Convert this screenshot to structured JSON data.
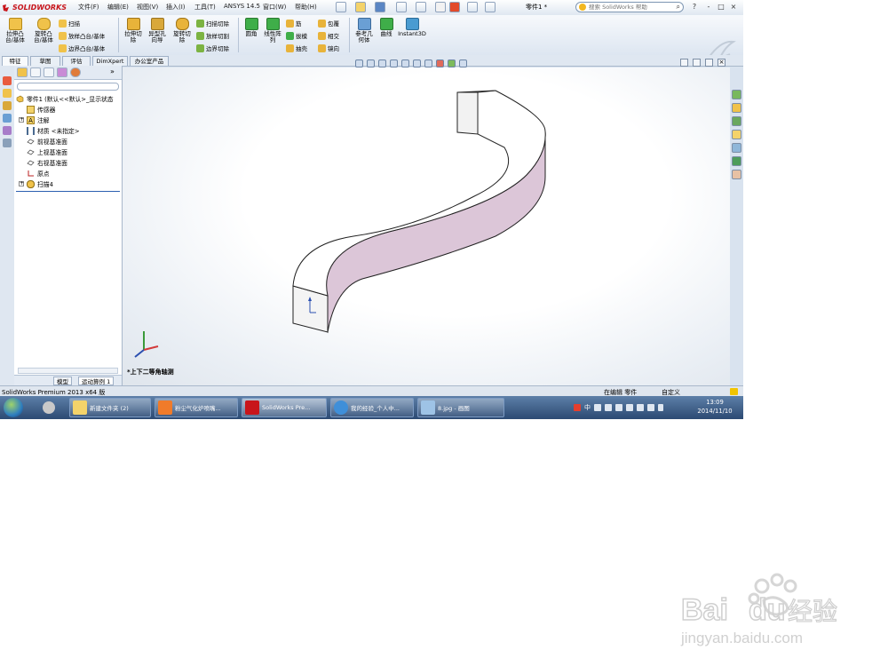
{
  "app": {
    "logo_text": "SOLIDWORKS",
    "menus": [
      "文件(F)",
      "编辑(E)",
      "视图(V)",
      "插入(I)",
      "工具(T)",
      "ANSYS 14.5",
      "窗口(W)",
      "帮助(H)"
    ],
    "document_title": "零件1 *",
    "help_search_placeholder": "搜索 SolidWorks 帮助",
    "window_controls": [
      "?",
      "-",
      "□",
      "×"
    ]
  },
  "command_manager": {
    "big_buttons": [
      {
        "label_1": "拉伸凸",
        "label_2": "台/基体",
        "icon": "extrude-boss-icon"
      },
      {
        "label_1": "旋转凸",
        "label_2": "台/基体",
        "icon": "revolve-boss-icon"
      },
      {
        "label_1": "拉伸切",
        "label_2": "除",
        "icon": "extrude-cut-icon"
      },
      {
        "label_1": "异型孔",
        "label_2": "向导",
        "icon": "hole-wizard-icon"
      },
      {
        "label_1": "旋转切",
        "label_2": "除",
        "icon": "revolve-cut-icon"
      },
      {
        "label_1": "圆角",
        "label_2": "",
        "icon": "fillet-icon"
      },
      {
        "label_1": "线性阵",
        "label_2": "列",
        "icon": "linear-pattern-icon"
      },
      {
        "label_1": "参考几",
        "label_2": "何体",
        "icon": "reference-geometry-icon"
      },
      {
        "label_1": "曲线",
        "label_2": "",
        "icon": "curves-icon"
      },
      {
        "label_1": "Instant3D",
        "label_2": "",
        "icon": "instant3d-icon"
      }
    ],
    "small_buttons": {
      "sweep": "扫描",
      "loft": "放样凸台/基体",
      "boundary": "边界凸台/基体",
      "swept_cut": "扫描切除",
      "lofted_cut": "放样切割",
      "boundary_cut": "边界切除",
      "rib": "筋",
      "draft": "拔模",
      "shell": "抽壳",
      "wrap": "包覆",
      "intersect": "相交",
      "mirror": "镜向"
    }
  },
  "tabs": [
    "特征",
    "草图",
    "评估",
    "DimXpert",
    "办公室产品"
  ],
  "feature_tree": {
    "root": "零件1 (默认<<默认>_显示状态",
    "items": [
      "传感器",
      "注解",
      "材质 <未指定>",
      "前视基准面",
      "上视基准面",
      "右视基准面",
      "原点",
      "扫描4"
    ],
    "bottom_tabs": [
      "模型",
      "运动算例 1"
    ]
  },
  "graphics": {
    "view_label": "*上下二等角轴测"
  },
  "status": {
    "product": "SolidWorks Premium 2013 x64 版",
    "mode": "在编辑 零件",
    "units": "自定义"
  },
  "taskbar": {
    "tasks": [
      "新建文件夹 (2)",
      "粉尘气化炉喷嘴...",
      "SolidWorks Pre...",
      "我的经验_个人中...",
      "8.jpg - 画图"
    ],
    "tray_text": "中",
    "time": "13:09",
    "date": "2014/11/10"
  },
  "watermark": {
    "brand": "Bai du 经验",
    "url": "jingyan.baidu.com"
  },
  "colors": {
    "sw_red": "#c8151b",
    "part_side": "#dcc6d8",
    "part_top": "#ffffff",
    "taskbar": "#2c4a73"
  }
}
